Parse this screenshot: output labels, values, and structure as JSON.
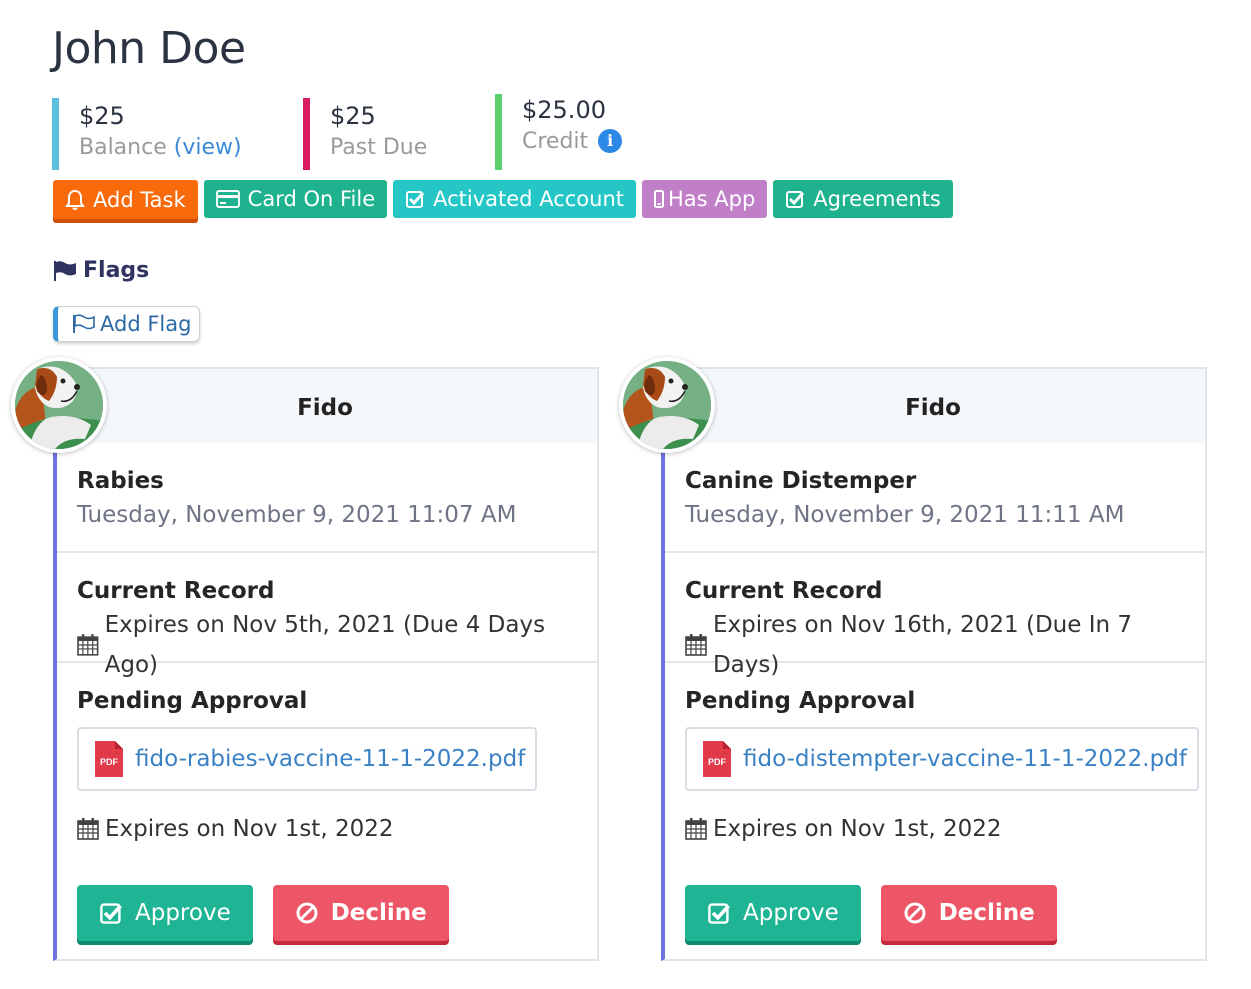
{
  "customer": {
    "name": "John Doe"
  },
  "stats": {
    "balance": {
      "amount": "$25",
      "label": "Balance",
      "link": "(view)",
      "color": "#5bc0de"
    },
    "past_due": {
      "amount": "$25",
      "label": "Past Due",
      "color": "#d81b60"
    },
    "credit": {
      "amount": "$25.00",
      "label": "Credit",
      "info_icon": "info-circle-icon",
      "color": "#5cd06c"
    }
  },
  "tags": [
    {
      "label": "Add Task",
      "icon": "bell-icon",
      "color": "#f96a0a"
    },
    {
      "label": "Card On File",
      "icon": "credit-card-icon",
      "color": "#1fb28e"
    },
    {
      "label": "Activated Account",
      "icon": "check-square-icon",
      "color": "#24c6c6"
    },
    {
      "label": "Has App",
      "icon": "mobile-icon",
      "color": "#c17fc7"
    },
    {
      "label": "Agreements",
      "icon": "check-square-icon",
      "color": "#1fb28e"
    }
  ],
  "flags": {
    "heading": "Flags",
    "add_label": "Add Flag"
  },
  "cards": [
    {
      "pet_name": "Fido",
      "vaccine": "Rabies",
      "submitted": "Tuesday, November 9, 2021 11:07 AM",
      "current_heading": "Current Record",
      "current_expiry": "Expires on Nov 5th, 2021 (Due 4 Days Ago)",
      "pending_heading": "Pending Approval",
      "file_name": "fido-rabies-vaccine-11-1-2022.pdf",
      "file_badge": "PDF",
      "pending_expiry": "Expires on Nov 1st, 2022",
      "approve_label": "Approve",
      "decline_label": "Decline"
    },
    {
      "pet_name": "Fido",
      "vaccine": "Canine Distemper",
      "submitted": "Tuesday, November 9, 2021 11:11 AM",
      "current_heading": "Current Record",
      "current_expiry": "Expires on Nov 16th, 2021 (Due In 7 Days)",
      "pending_heading": "Pending Approval",
      "file_name": "fido-distempter-vaccine-11-1-2022.pdf",
      "file_badge": "PDF",
      "pending_expiry": "Expires on Nov 1st, 2022",
      "approve_label": "Approve",
      "decline_label": "Decline"
    }
  ]
}
